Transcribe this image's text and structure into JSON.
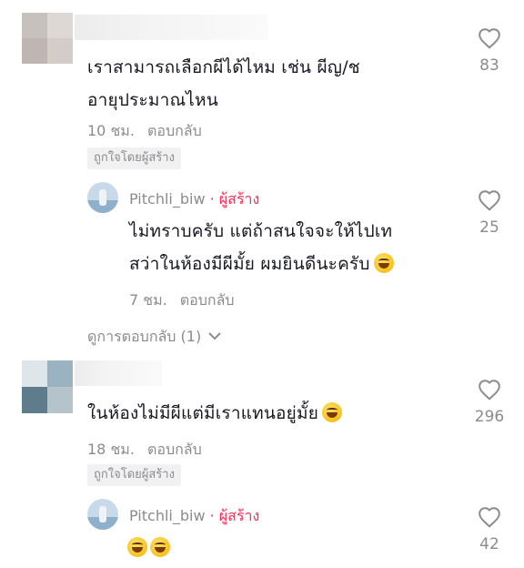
{
  "comments": [
    {
      "text_line1": "เราสามารถเลือกผีได้ไหม เช่น ผีญ/ช",
      "text_line2": "อายุประมาณไหน",
      "time": "10 ชม.",
      "reply_label": "ตอบกลับ",
      "liked_by_creator": "ถูกใจโดยผู้สร้าง",
      "likes": "83",
      "reply": {
        "username": "Pitchli_biw",
        "creator_tag": "· ผู้สร้าง",
        "text_line1": "ไม่ทราบครับ แต่ถ้าสนใจจะให้ไปเท",
        "text_line2": "สว่าในห้องมีผีมั้ย ผมยินดีนะครับ",
        "emoji": "rolling-on-floor-laughing",
        "time": "7 ชม.",
        "reply_label": "ตอบกลับ",
        "likes": "25"
      },
      "view_replies": "ดูการตอบกลับ (1)"
    },
    {
      "text_line1": "ในห้องไม่มีผีแต่มีเราแทนอยู่มั้ย",
      "emoji": "grinning-sweat",
      "time": "18 ชม.",
      "reply_label": "ตอบกลับ",
      "liked_by_creator": "ถูกใจโดยผู้สร้าง",
      "likes": "296",
      "reply": {
        "username": "Pitchli_biw",
        "creator_tag": "· ผู้สร้าง",
        "emojis": [
          "grinning-sweat",
          "grinning-sweat"
        ],
        "likes": "42"
      }
    }
  ],
  "colors": {
    "text": "#161823",
    "muted": "#8a8b91",
    "creator": "#fe2c55",
    "badge_bg": "#f1f1f2"
  }
}
